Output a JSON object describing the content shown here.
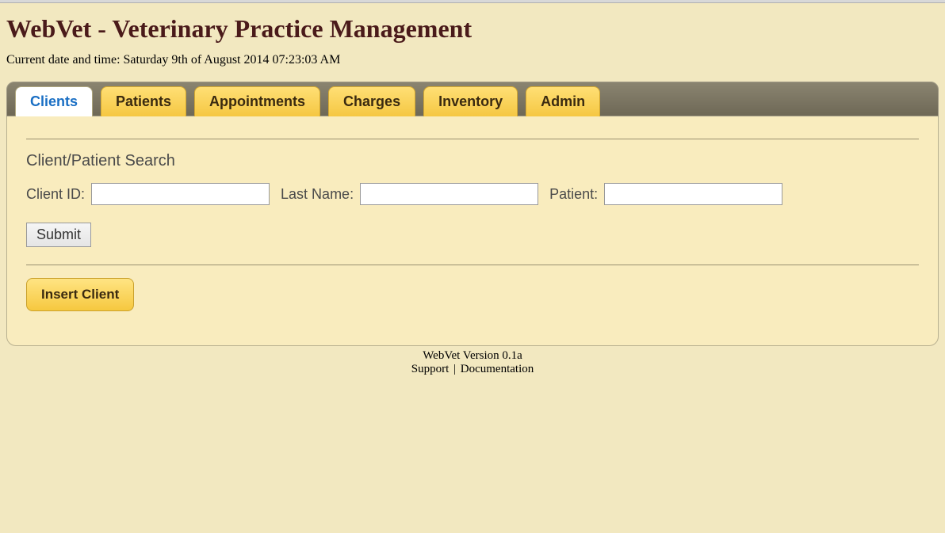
{
  "header": {
    "title": "WebVet - Veterinary Practice Management",
    "datetime_label": "Current date and time: Saturday 9th of August 2014 07:23:03 AM"
  },
  "tabs": [
    {
      "label": "Clients",
      "active": true
    },
    {
      "label": "Patients",
      "active": false
    },
    {
      "label": "Appointments",
      "active": false
    },
    {
      "label": "Charges",
      "active": false
    },
    {
      "label": "Inventory",
      "active": false
    },
    {
      "label": "Admin",
      "active": false
    }
  ],
  "search": {
    "section_title": "Client/Patient Search",
    "fields": {
      "client_id": {
        "label": "Client ID:",
        "value": ""
      },
      "last_name": {
        "label": "Last Name:",
        "value": ""
      },
      "patient": {
        "label": "Patient:",
        "value": ""
      }
    },
    "submit_label": "Submit"
  },
  "actions": {
    "insert_client_label": "Insert Client"
  },
  "footer": {
    "version": "WebVet Version 0.1a",
    "support_label": "Support",
    "documentation_label": "Documentation",
    "separator": " | "
  }
}
